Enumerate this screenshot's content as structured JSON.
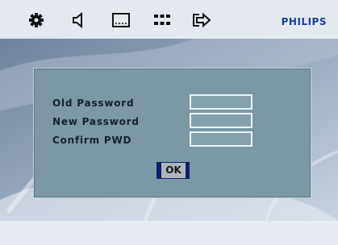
{
  "topbar": {
    "icons": [
      "gear-icon",
      "speaker-icon",
      "screen-icon",
      "grid-icon",
      "exit-icon"
    ],
    "brand": "PHILIPS"
  },
  "dialog": {
    "old_label": "Old Password",
    "new_label": "New Password",
    "confirm_label": "Confirm PWD",
    "old_value": "",
    "new_value": "",
    "confirm_value": "",
    "ok_label": "OK"
  },
  "colors": {
    "brand": "#1b3f9c",
    "dialog_bg": "#7b98a4",
    "selection": "#0e1f66"
  }
}
